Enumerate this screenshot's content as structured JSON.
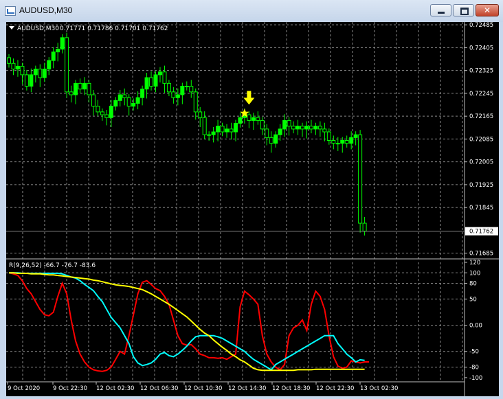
{
  "window": {
    "title": "AUDUSD,M30",
    "buttons": {
      "minimize": "minimize",
      "maximize": "maximize",
      "close": "close"
    }
  },
  "chart_data": [
    {
      "type": "candlestick",
      "symbol_label": "AUDUSD,M30",
      "ohlc_label": "0.71771 0.71786 0.71701 0.71762",
      "current_price": "0.71762",
      "y_ticks": [
        "0.72485",
        "0.72405",
        "0.72325",
        "0.72245",
        "0.72165",
        "0.72085",
        "0.72005",
        "0.71925",
        "0.71845",
        "0.71685"
      ],
      "ylim": [
        0.71665,
        0.72495
      ],
      "x_ticks": [
        "9 Oct 2020",
        "9 Oct 22:30",
        "12 Oct 02:30",
        "12 Oct 06:30",
        "12 Oct 10:30",
        "12 Oct 14:30",
        "12 Oct 18:30",
        "12 Oct 22:30",
        "13 Oct 02:30"
      ],
      "grid": true,
      "up_color": "#00ff00",
      "down_color": "#000000",
      "closes": [
        0.7235,
        0.7233,
        0.7234,
        0.7231,
        0.7227,
        0.7231,
        0.7233,
        0.723,
        0.7233,
        0.7236,
        0.7239,
        0.724,
        0.7244,
        0.7225,
        0.7224,
        0.7228,
        0.7226,
        0.7228,
        0.7224,
        0.722,
        0.7218,
        0.7217,
        0.7216,
        0.722,
        0.7222,
        0.7224,
        0.7223,
        0.722,
        0.7221,
        0.7223,
        0.7226,
        0.723,
        0.7227,
        0.7231,
        0.7232,
        0.7228,
        0.7225,
        0.7223,
        0.7224,
        0.7227,
        0.7227,
        0.7225,
        0.7218,
        0.7216,
        0.721,
        0.721,
        0.7211,
        0.7213,
        0.7211,
        0.7212,
        0.7211,
        0.7214,
        0.7216,
        0.7217,
        0.7215,
        0.7216,
        0.7215,
        0.7212,
        0.7209,
        0.7207,
        0.721,
        0.7212,
        0.7215,
        0.7213,
        0.7212,
        0.7213,
        0.7212,
        0.7213,
        0.7212,
        0.7213,
        0.7212,
        0.7211,
        0.7208,
        0.7207,
        0.7207,
        0.7208,
        0.7207,
        0.7209,
        0.721,
        0.7179,
        0.71762
      ],
      "annotations": [
        {
          "type": "arrow-down",
          "color": "#ffff00",
          "at_index": 54,
          "value": 0.72215
        },
        {
          "type": "star",
          "color": "#ffff00",
          "at_index": 53,
          "value": 0.72175
        }
      ]
    },
    {
      "type": "line",
      "title": "R(9,26,52) -66.7 -76.7 -83.6",
      "y_ticks": [
        "120",
        "100",
        "80",
        "50",
        "0.00",
        "-50",
        "-80",
        "-100"
      ],
      "ylim": [
        -108,
        120
      ],
      "series": [
        {
          "color": "#ff0000",
          "values": [
            100,
            98,
            95,
            85,
            70,
            60,
            45,
            30,
            20,
            18,
            25,
            55,
            80,
            60,
            10,
            -30,
            -55,
            -70,
            -80,
            -85,
            -87,
            -88,
            -86,
            -80,
            -65,
            -50,
            -55,
            -20,
            20,
            60,
            82,
            85,
            78,
            70,
            66,
            55,
            40,
            10,
            -20,
            -35,
            -38,
            -37,
            -45,
            -55,
            -58,
            -62,
            -62,
            -63,
            -62,
            -65,
            -60,
            -55,
            35,
            65,
            58,
            50,
            40,
            -20,
            -55,
            -70,
            -80,
            -85,
            -75,
            -20,
            -5,
            0,
            10,
            -10,
            40,
            65,
            55,
            30,
            -20,
            -60,
            -78,
            -82,
            -80,
            -68,
            -70,
            -72,
            -70,
            -70
          ]
        },
        {
          "color": "#00ffff",
          "values": [
            100,
            100,
            100,
            99,
            99,
            99,
            99,
            99,
            99,
            99,
            99,
            99,
            98,
            95,
            92,
            90,
            85,
            78,
            72,
            66,
            55,
            45,
            30,
            15,
            5,
            -5,
            -20,
            -35,
            -60,
            -72,
            -77,
            -75,
            -72,
            -65,
            -55,
            -52,
            -58,
            -60,
            -55,
            -48,
            -40,
            -30,
            -22,
            -20,
            -20,
            -20,
            -20,
            -22,
            -25,
            -30,
            -35,
            -40,
            -45,
            -50,
            -58,
            -65,
            -70,
            -75,
            -80,
            -85,
            -75,
            -70,
            -65,
            -60,
            -55,
            -50,
            -45,
            -40,
            -35,
            -30,
            -25,
            -20,
            -20,
            -20,
            -35,
            -45,
            -55,
            -62,
            -70,
            -66,
            -67
          ]
        },
        {
          "color": "#ffff00",
          "values": [
            100,
            100,
            99,
            99,
            99,
            98,
            98,
            98,
            97,
            96,
            96,
            95,
            94,
            93,
            92,
            91,
            90,
            89,
            88,
            86,
            85,
            83,
            81,
            79,
            77,
            76,
            75,
            74,
            72,
            70,
            68,
            64,
            60,
            55,
            50,
            45,
            40,
            34,
            28,
            22,
            16,
            8,
            0,
            -8,
            -15,
            -20,
            -28,
            -35,
            -42,
            -48,
            -55,
            -60,
            -66,
            -70,
            -76,
            -82,
            -85,
            -86,
            -86,
            -86,
            -86,
            -86,
            -86,
            -86,
            -86,
            -85,
            -85,
            -85,
            -85,
            -84,
            -84,
            -84,
            -84,
            -84,
            -84,
            -84,
            -84,
            -84,
            -84,
            -84,
            -84
          ]
        }
      ]
    }
  ]
}
